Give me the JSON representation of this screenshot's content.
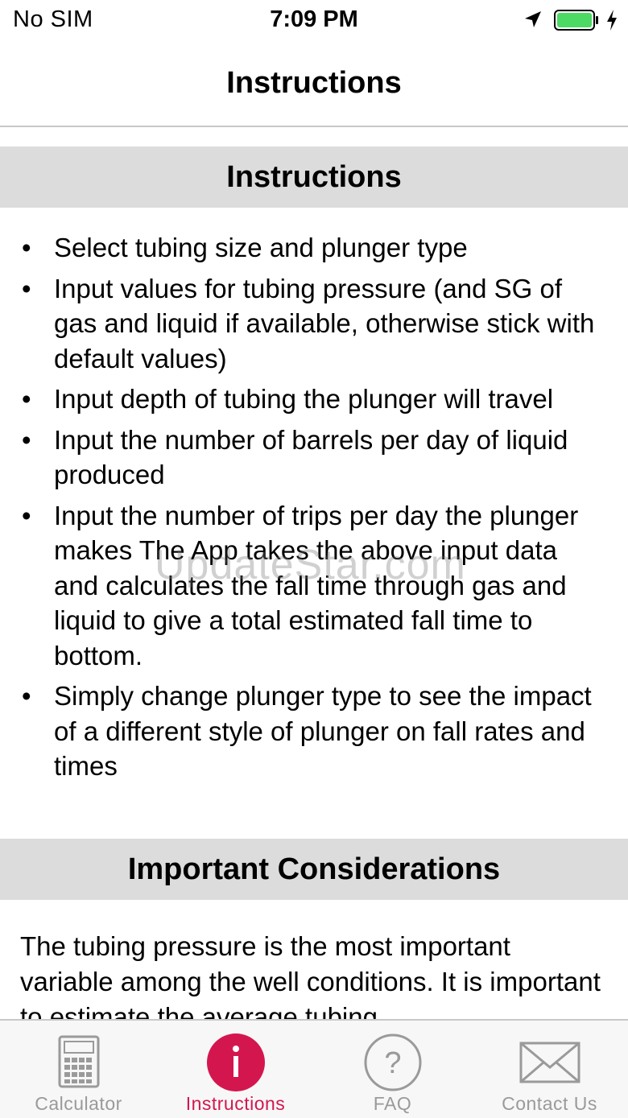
{
  "status_bar": {
    "carrier": "No SIM",
    "time": "7:09 PM"
  },
  "nav": {
    "title": "Instructions"
  },
  "sections": {
    "instructions": {
      "heading": "Instructions",
      "items": [
        "Select tubing size and plunger type",
        "Input values for tubing pressure (and SG of gas and liquid if available, otherwise stick with default values)",
        "Input depth of tubing the plunger will travel",
        "Input the number of barrels per day of liquid produced",
        "Input the number of trips per day the plunger makes The App takes the above input data and calculates the fall time through gas and liquid to give a total estimated fall time to bottom.",
        "Simply change plunger type to see the impact of a different style of plunger on fall rates and times"
      ]
    },
    "considerations": {
      "heading": "Important Considerations",
      "paragraph": "The tubing pressure is the most important variable among the well conditions. It is important to estimate the average tubing"
    }
  },
  "watermark": "UpdateStar.com",
  "tabs": [
    {
      "label": "Calculator",
      "icon": "calculator-icon"
    },
    {
      "label": "Instructions",
      "icon": "info-icon",
      "active": true
    },
    {
      "label": "FAQ",
      "icon": "question-icon"
    },
    {
      "label": "Contact Us",
      "icon": "envelope-icon"
    }
  ],
  "colors": {
    "accent": "#d3174e",
    "battery": "#4cd964",
    "header_bg": "#dcdcdc",
    "inactive": "#9a9a9a"
  }
}
